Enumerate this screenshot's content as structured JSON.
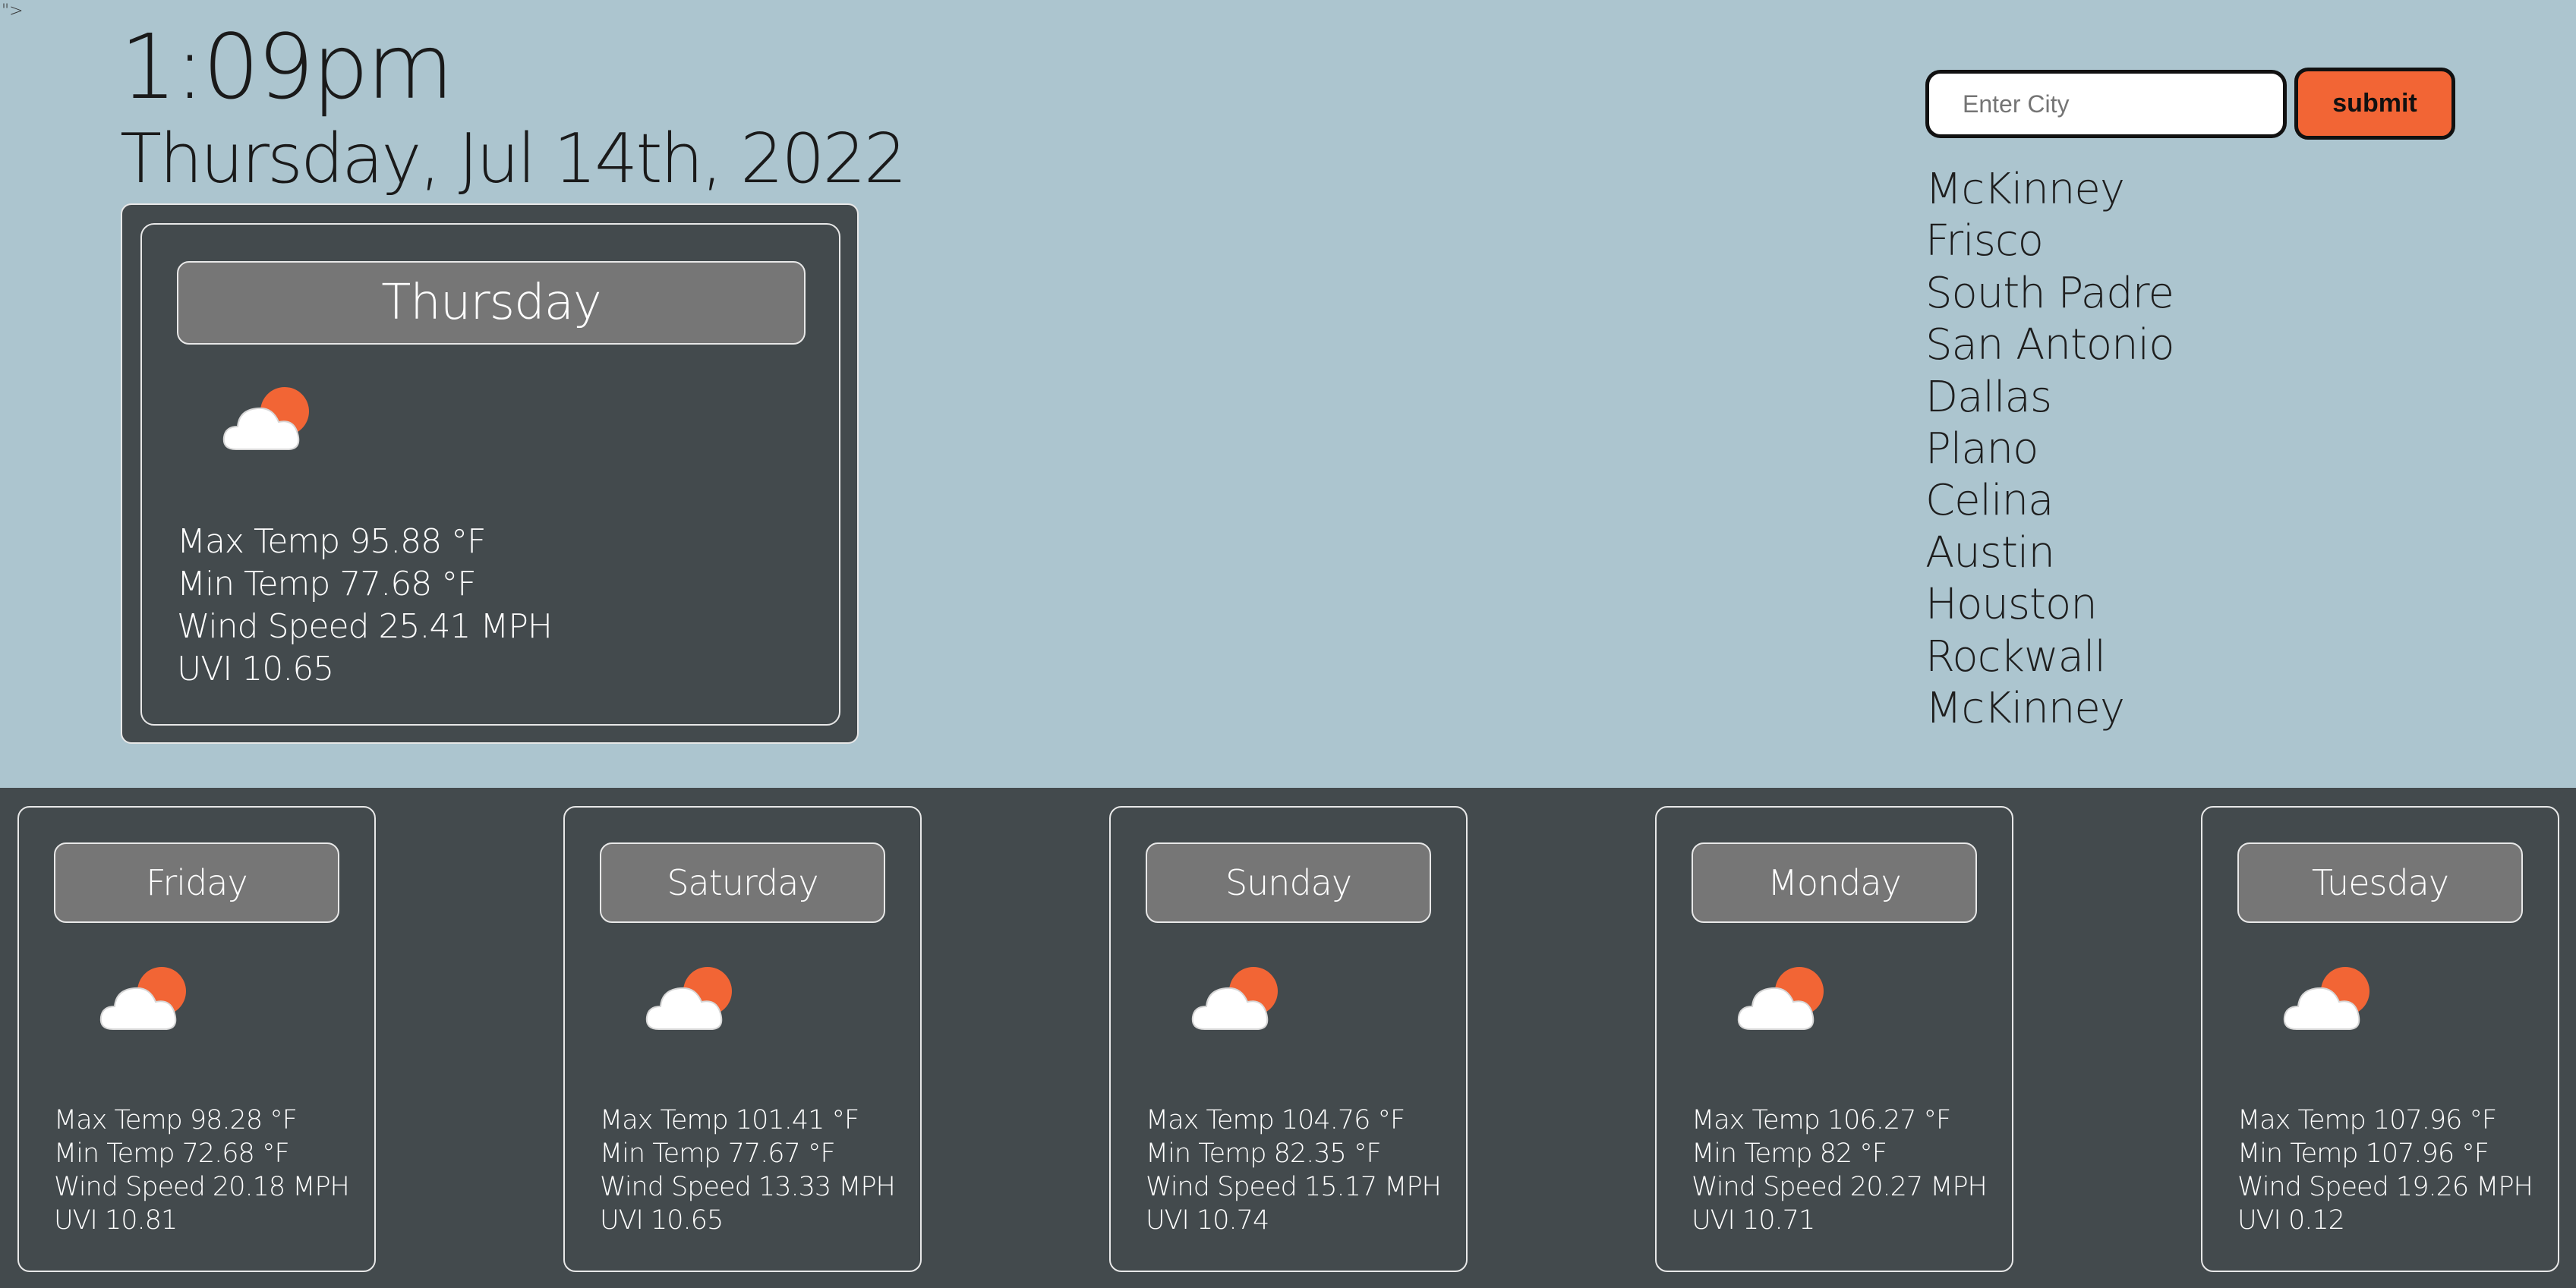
{
  "stray_text": "\">",
  "header": {
    "time": "1:09pm",
    "date": "Thursday, Jul 14th, 2022"
  },
  "today": {
    "day": "Thursday",
    "icon": "cloud-sun-icon",
    "max_temp": "Max Temp 95.88 °F",
    "min_temp": "Min Temp 77.68 °F",
    "wind": "Wind Speed 25.41 MPH",
    "uvi": "UVI 10.65"
  },
  "search": {
    "placeholder": "Enter City",
    "value": "",
    "submit_label": "submit"
  },
  "history": [
    "McKinney",
    "Frisco",
    "South Padre",
    "San Antonio",
    "Dallas",
    "Plano",
    "Celina",
    "Austin",
    "Houston",
    "Rockwall",
    "McKinney"
  ],
  "colors": {
    "background": "#acc5cf",
    "panel": "#434a4d",
    "day_header": "#767676",
    "accent": "#f26535"
  },
  "forecast": [
    {
      "day": "Friday",
      "icon": "cloud-sun-icon",
      "max_temp": "Max Temp 98.28 °F",
      "min_temp": "Min Temp 72.68 °F",
      "wind": "Wind Speed 20.18 MPH",
      "uvi": "UVI 10.81"
    },
    {
      "day": "Saturday",
      "icon": "cloud-sun-icon",
      "max_temp": "Max Temp 101.41 °F",
      "min_temp": "Min Temp 77.67 °F",
      "wind": "Wind Speed 13.33 MPH",
      "uvi": "UVI 10.65"
    },
    {
      "day": "Sunday",
      "icon": "cloud-sun-icon",
      "max_temp": "Max Temp 104.76 °F",
      "min_temp": "Min Temp 82.35 °F",
      "wind": "Wind Speed 15.17 MPH",
      "uvi": "UVI 10.74"
    },
    {
      "day": "Monday",
      "icon": "cloud-sun-icon",
      "max_temp": "Max Temp 106.27 °F",
      "min_temp": "Min Temp 82 °F",
      "wind": "Wind Speed 20.27 MPH",
      "uvi": "UVI 10.71"
    },
    {
      "day": "Tuesday",
      "icon": "cloud-sun-icon",
      "max_temp": "Max Temp 107.96 °F",
      "min_temp": "Min Temp 107.96 °F",
      "wind": "Wind Speed 19.26 MPH",
      "uvi": "UVI 0.12"
    }
  ]
}
